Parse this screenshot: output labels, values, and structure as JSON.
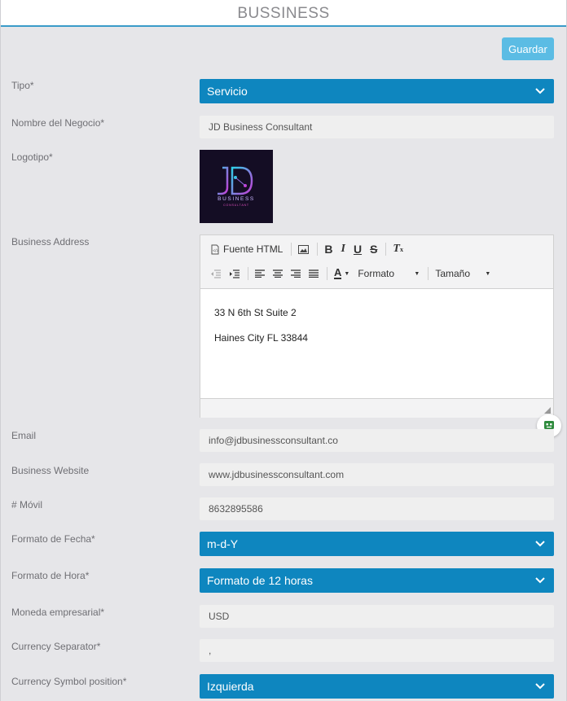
{
  "page": {
    "title": "BUSSINESS"
  },
  "toolbar": {
    "save_label": "Guardar"
  },
  "colors": {
    "accent": "#0e86bf",
    "save_button": "#5bbce4",
    "header_border": "#3a9bc9"
  },
  "form": {
    "tipo": {
      "label": "Tipo*",
      "value": "Servicio"
    },
    "business_name": {
      "label": "Nombre del Negocio*",
      "value": "JD Business Consultant"
    },
    "logo": {
      "label": "Logotipo*",
      "text_main": "JD",
      "text_line1": "BUSINESS",
      "text_line2": "CONSULTANT"
    },
    "address": {
      "label": "Business Address",
      "editor_toolbar": {
        "source_label": "Fuente HTML",
        "format_label": "Formato",
        "size_label": "Tamaño"
      },
      "lines": [
        "33 N 6th St Suite 2",
        "Haines City FL 33844"
      ]
    },
    "email": {
      "label": "Email",
      "value": "info@jdbusinessconsultant.co"
    },
    "website": {
      "label": "Business Website",
      "value": "www.jdbusinessconsultant.com"
    },
    "mobile": {
      "label": "# Móvil",
      "value": "8632895586"
    },
    "date_format": {
      "label": "Formato de Fecha*",
      "value": "m-d-Y"
    },
    "time_format": {
      "label": "Formato de Hora*",
      "value": "Formato de 12 horas"
    },
    "currency": {
      "label": "Moneda empresarial*",
      "value": "USD"
    },
    "currency_separator": {
      "label": "Currency Separator*",
      "value": ","
    },
    "currency_symbol_position": {
      "label": "Currency Symbol position*",
      "value": "Izquierda"
    }
  }
}
